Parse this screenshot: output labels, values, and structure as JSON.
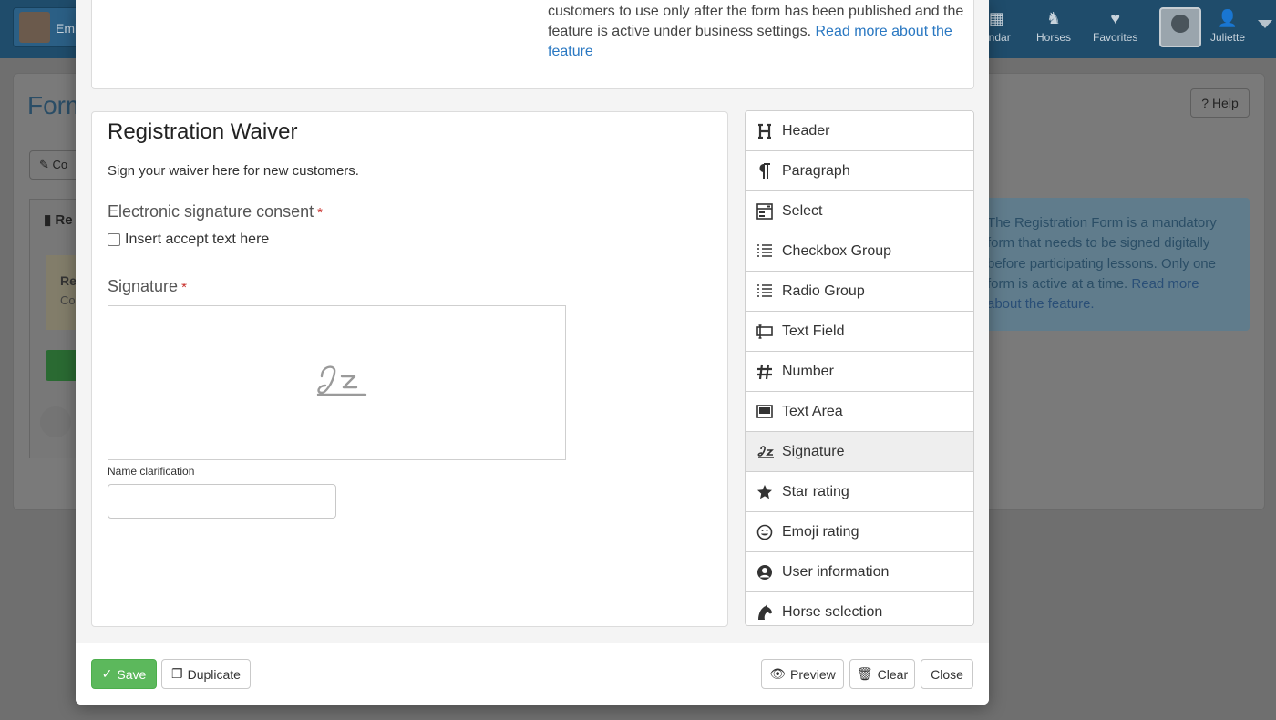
{
  "app": {
    "brand_text": "Emi",
    "nav": [
      {
        "label": "endar",
        "icon": "calendar-icon"
      },
      {
        "label": "Horses",
        "icon": "horse-icon"
      },
      {
        "label": "Favorites",
        "icon": "heart-icon"
      }
    ],
    "user_name": "Juliette",
    "page_title": "Form",
    "help_label": "Help",
    "background_button_label": "Co",
    "background_card_title": "Re",
    "background_card_sub1": "Re",
    "background_card_sub2": "Co",
    "info_text": "The Registration Form is a mandatory form that needs to be signed digitally before participating lessons. Only one form is active at a time. ",
    "info_link": "Read more about the feature."
  },
  "modal": {
    "notice_text": "customers to use only after the form has been published and the feature is active under business settings. ",
    "notice_link": "Read more about the feature",
    "form": {
      "title": "Registration Waiver",
      "description": "Sign your waiver here for new customers.",
      "consent_label": "Electronic signature consent",
      "required_mark": "*",
      "checkbox_label": "Insert accept text here",
      "signature_label": "Signature",
      "name_clarification_label": "Name clarification"
    },
    "field_types": [
      {
        "label": "Header",
        "icon": "header-icon"
      },
      {
        "label": "Paragraph",
        "icon": "paragraph-icon"
      },
      {
        "label": "Select",
        "icon": "select-icon"
      },
      {
        "label": "Checkbox Group",
        "icon": "checkbox-group-icon"
      },
      {
        "label": "Radio Group",
        "icon": "radio-group-icon"
      },
      {
        "label": "Text Field",
        "icon": "text-field-icon"
      },
      {
        "label": "Number",
        "icon": "number-icon"
      },
      {
        "label": "Text Area",
        "icon": "text-area-icon"
      },
      {
        "label": "Signature",
        "icon": "signature-icon"
      },
      {
        "label": "Star rating",
        "icon": "star-icon"
      },
      {
        "label": "Emoji rating",
        "icon": "emoji-icon"
      },
      {
        "label": "User information",
        "icon": "user-icon"
      },
      {
        "label": "Horse selection",
        "icon": "horse-icon"
      }
    ],
    "footer": {
      "save": "Save",
      "duplicate": "Duplicate",
      "preview": "Preview",
      "clear": "Clear",
      "close": "Close"
    }
  },
  "colors": {
    "primary_nav": "#1f4c6b",
    "link": "#2a78c2",
    "save_green": "#5cb85c",
    "required_red": "#c9302c"
  }
}
